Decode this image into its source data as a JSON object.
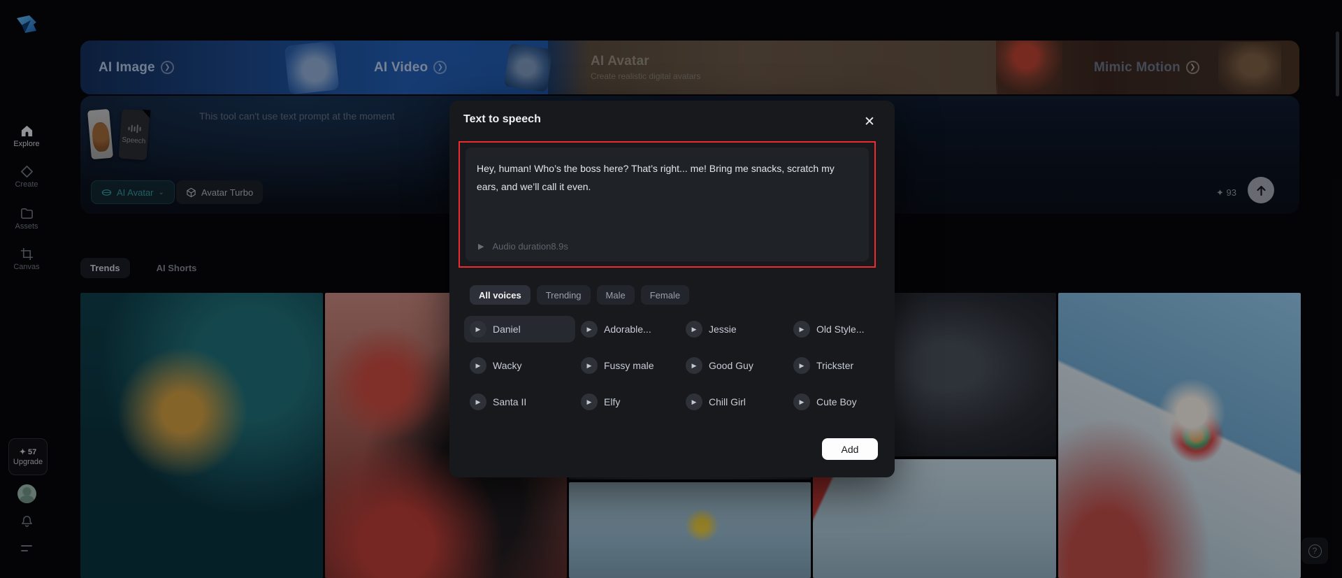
{
  "accent": {
    "red": "#ee2b2f",
    "teal": "#2f8f97",
    "blue": "#1e56a6"
  },
  "sidebar": {
    "items": [
      {
        "label": "Explore"
      },
      {
        "label": "Create"
      },
      {
        "label": "Assets"
      },
      {
        "label": "Canvas"
      }
    ],
    "upgrade": {
      "credits": "✦ 57",
      "label": "Upgrade"
    }
  },
  "banner": {
    "tabs": [
      {
        "label": "AI Image"
      },
      {
        "label": "AI Video"
      },
      {
        "label": "AI Avatar",
        "subtitle": "Create realistic digital avatars"
      },
      {
        "label": "Mimic Motion"
      }
    ]
  },
  "prompt": {
    "notice": "This tool can't use text prompt at the moment",
    "attachment_label": "Speech",
    "model_chip": "AI Avatar",
    "mode_chip": "Avatar Turbo",
    "credits": "✦ 93"
  },
  "content": {
    "tabs": [
      {
        "label": "Trends"
      },
      {
        "label": "AI Shorts"
      }
    ]
  },
  "modal": {
    "title": "Text to speech",
    "close_glyph": "✕",
    "text": "Hey, human! Who’s the boss here? That’s right... me! Bring me snacks, scratch my ears, and we’ll call it even.",
    "audio_label": "Audio duration",
    "audio_duration": "8.9s",
    "filters": [
      {
        "label": "All voices"
      },
      {
        "label": "Trending"
      },
      {
        "label": "Male"
      },
      {
        "label": "Female"
      }
    ],
    "voices": [
      {
        "name": "Daniel"
      },
      {
        "name": "Adorable..."
      },
      {
        "name": "Jessie"
      },
      {
        "name": "Old Style..."
      },
      {
        "name": "Wacky"
      },
      {
        "name": "Fussy male"
      },
      {
        "name": "Good Guy"
      },
      {
        "name": "Trickster"
      },
      {
        "name": "Santa II"
      },
      {
        "name": "Elfy"
      },
      {
        "name": "Chill Girl"
      },
      {
        "name": "Cute Boy"
      }
    ],
    "add_label": "Add"
  }
}
